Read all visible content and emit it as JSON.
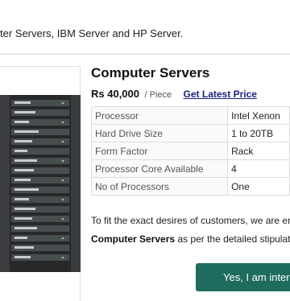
{
  "intro_text": "ter Servers, IBM Server and HP Server.",
  "product": {
    "title": "Computer Servers",
    "price": "Rs 40,000",
    "price_unit": "/ Piece",
    "latest_price_link": "Get Latest Price",
    "specs": [
      {
        "key": "Processor",
        "value": "Intel Xenon"
      },
      {
        "key": "Hard Drive Size",
        "value": "1 to 20TB"
      },
      {
        "key": "Form Factor",
        "value": "Rack"
      },
      {
        "key": "Processor Core Available",
        "value": "4"
      },
      {
        "key": "No of Processors",
        "value": "One"
      }
    ],
    "description_line1": "To fit the exact desires of customers, we are en",
    "description_line2_bold": "Computer Servers",
    "description_line2_rest": " as per the detailed stipulat",
    "cta_label": "Yes, I am inter"
  },
  "colors": {
    "cta_background": "#1f6b5e",
    "link": "#1a237e"
  }
}
